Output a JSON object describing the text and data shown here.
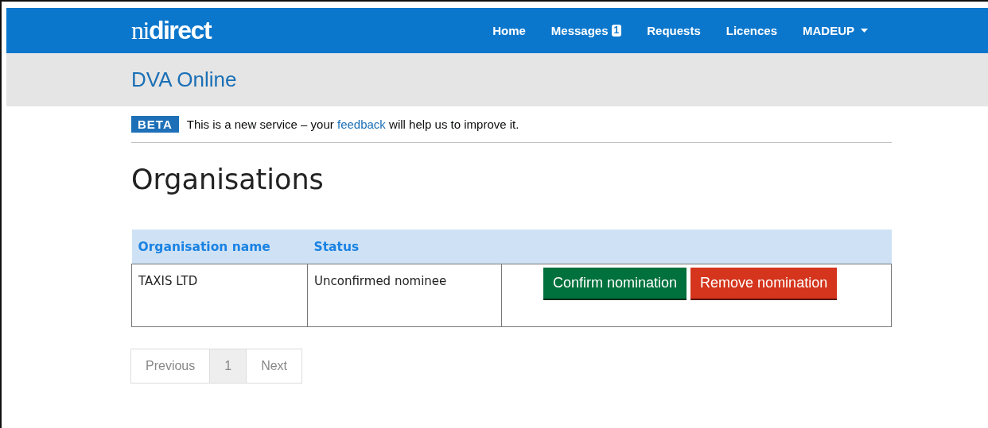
{
  "header": {
    "logo": "ni**direct**",
    "nav": [
      {
        "label": "Home"
      },
      {
        "label": "Messages",
        "badge": "1"
      },
      {
        "label": "Requests"
      },
      {
        "label": "Licences"
      },
      {
        "label": "MADEUP",
        "dropdown": true
      }
    ]
  },
  "service_title": "DVA Online",
  "beta_banner": {
    "tag": "BETA",
    "text_before": "This is a new service – your",
    "link": "feedback",
    "text_after": "will help us to improve it."
  },
  "heading": "Organisations",
  "table": {
    "columns": [
      "Organisation name",
      "Status"
    ],
    "rows": [
      {
        "cells": [
          "TAXIS LTD",
          "Unconfirmed nominee"
        ],
        "actions": [
          {
            "label": "Confirm nomination",
            "kind": "confirm"
          },
          {
            "label": "Remove nomination",
            "kind": "remove"
          }
        ]
      }
    ]
  },
  "pagination": {
    "previous": {
      "label": "Previous",
      "disabled": true
    },
    "pages": [
      {
        "label": "1",
        "selected": true
      }
    ],
    "next": {
      "label": "Next",
      "disabled": true
    }
  }
}
